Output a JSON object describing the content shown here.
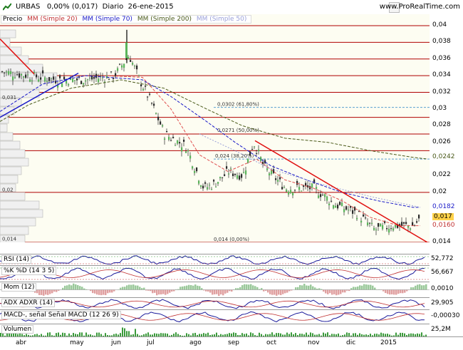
{
  "header": {
    "symbol": "URBAS",
    "change": "0,00% (0,017)",
    "period": "Diario",
    "date": "26-ene-2015",
    "site": "www.ProRealTime.com"
  },
  "legend": {
    "price": "Precio",
    "ma20": "MM (Simple 20)",
    "ma70": "MM (Simple 70)",
    "ma200": "MM (Simple 200)",
    "ma50": "MM (Simple 50)"
  },
  "watermark": "© ProRealTime.com",
  "colors": {
    "ma20": "#e05050",
    "ma70": "#1a1ac8",
    "ma200": "#4a5a1a",
    "ma50": "#9aa0d8",
    "trend": "#e01010",
    "hline": "#b00000"
  },
  "price_axis": [
    "0,04",
    "0,038",
    "0,036",
    "0,034",
    "0,032",
    "0,03",
    "0,028",
    "0,026",
    "0,0242",
    "0,022",
    "0,02",
    "0,0182",
    "0,017",
    "0,0160",
    "0,014"
  ],
  "highlight": {
    "current": "0,017",
    "ma20_val": "0,0160",
    "ma70_val": "0,0182",
    "ma200_val": "0,0242"
  },
  "fibo": [
    {
      "label": "0,0302 (61,80%)",
      "value": 0.0302
    },
    {
      "label": "0,0271 (50,00%)",
      "value": 0.0271
    },
    {
      "label": "0,024 (38,20%)",
      "value": 0.024
    },
    {
      "label": "0,014 (0,00%)",
      "value": 0.014
    }
  ],
  "volume_profile_labels": {
    "top": "0,031",
    "mid": "0,02",
    "bottom": "0,014"
  },
  "indicators": [
    {
      "key": "rsi",
      "label": "RSI (14)",
      "value": "52,772"
    },
    {
      "key": "stoch",
      "label": "%K  %D (14 3 5)",
      "value": "56,667"
    },
    {
      "key": "mom",
      "label": "Mom (12)",
      "value": "0,0010"
    },
    {
      "key": "adx",
      "label": "ADX  ADXR (14)",
      "value": "29,905"
    },
    {
      "key": "macd",
      "label": "MACD-, señal  Señal  MACD (12 26 9)",
      "value": "-0,00030"
    },
    {
      "key": "vol",
      "label": "Volumen",
      "value": "25,2M"
    }
  ],
  "months": [
    "abr",
    "may",
    "jun",
    "jul",
    "ago",
    "sep",
    "oct",
    "nov",
    "dic",
    "2015"
  ]
}
